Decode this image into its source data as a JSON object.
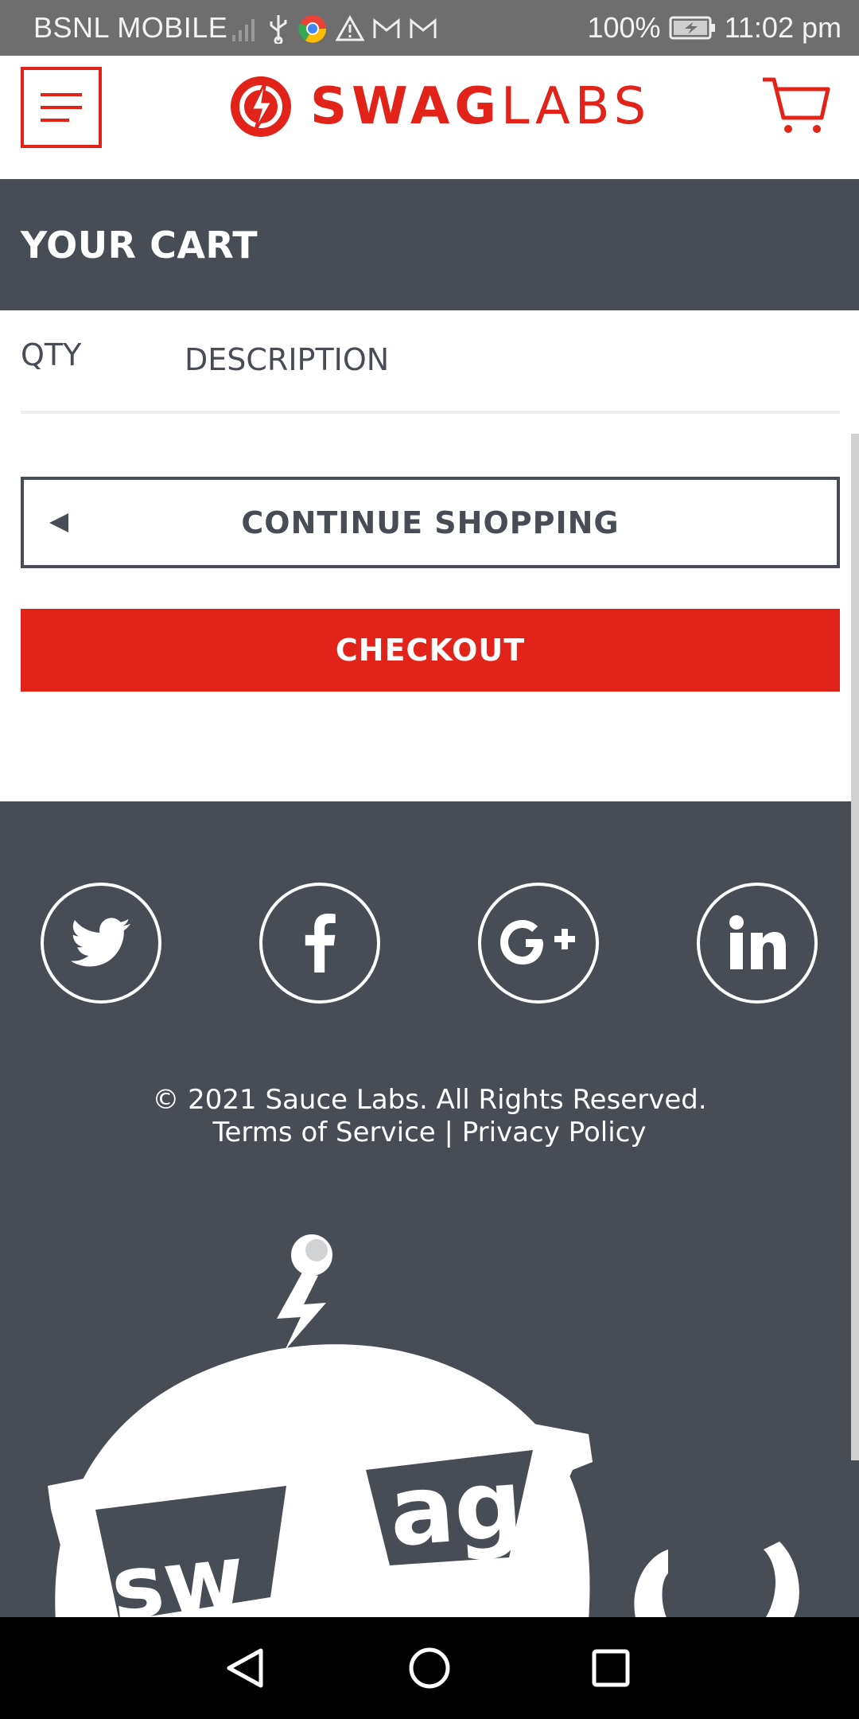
{
  "status_bar": {
    "carrier": "BSNL MOBILE",
    "battery": "100%",
    "time": "11:02 pm"
  },
  "header": {
    "logo_bold": "SWAG",
    "logo_light": "LABS",
    "brand_color": "#e2231a"
  },
  "title_bar": {
    "title": "YOUR CART"
  },
  "cart": {
    "qty_label": "QTY",
    "description_label": "DESCRIPTION",
    "continue_label": "CONTINUE SHOPPING",
    "checkout_label": "CHECKOUT"
  },
  "footer": {
    "social": [
      {
        "name": "twitter-icon"
      },
      {
        "name": "facebook-icon"
      },
      {
        "name": "google-plus-icon"
      },
      {
        "name": "linkedin-icon"
      }
    ],
    "copyright": "© 2021 Sauce Labs. All Rights Reserved.",
    "links": "Terms of Service | Privacy Policy",
    "background": "#474c55"
  }
}
